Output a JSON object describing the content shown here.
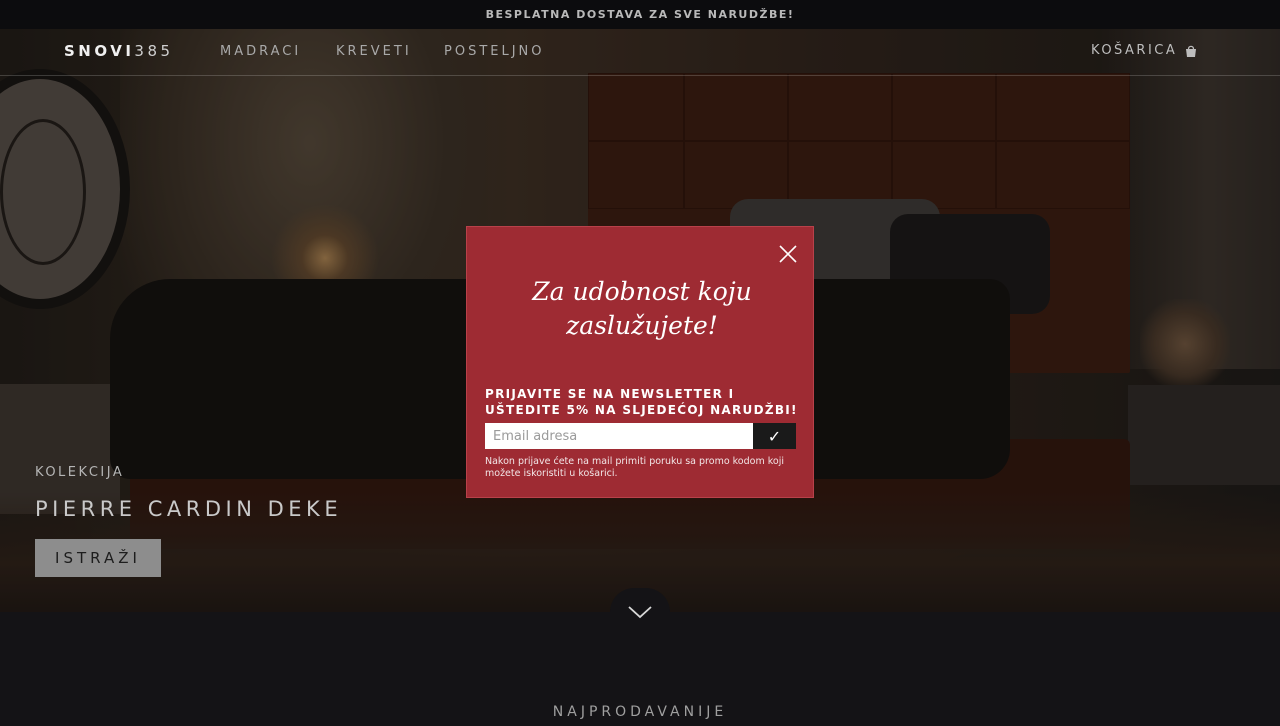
{
  "announcement": "BESPLATNA DOSTAVA ZA SVE NARUDŽBE!",
  "header": {
    "logo_bold": "SNOVI",
    "logo_light": "385",
    "nav": [
      {
        "label": "MADRACI"
      },
      {
        "label": "KREVETI"
      },
      {
        "label": "POSTELJNO"
      }
    ],
    "cart_label": "KOŠARICA",
    "cart_icon": "shopping-bag-icon"
  },
  "hero": {
    "eyebrow": "KOLEKCIJA",
    "title": "PIERRE CARDIN DEKE",
    "button_label": "ISTRAŽI",
    "scroll_icon": "chevron-down-icon"
  },
  "section": {
    "title": "NAJPRODAVANIJE"
  },
  "modal": {
    "heading_line1": "Za udobnost koju",
    "heading_line2": "zaslužujete!",
    "subheading": "PRIJAVITE SE NA NEWSLETTER I UŠTEDITE 5% NA SLJEDEĆOJ NARUDŽBI!",
    "email_placeholder": "Email adresa",
    "submit_label": "✓",
    "note": "Nakon prijave ćete na mail primiti poruku sa promo kodom koji možete iskoristiti u košarici.",
    "close_icon": "close-icon",
    "accent_color": "#9e2b33"
  }
}
